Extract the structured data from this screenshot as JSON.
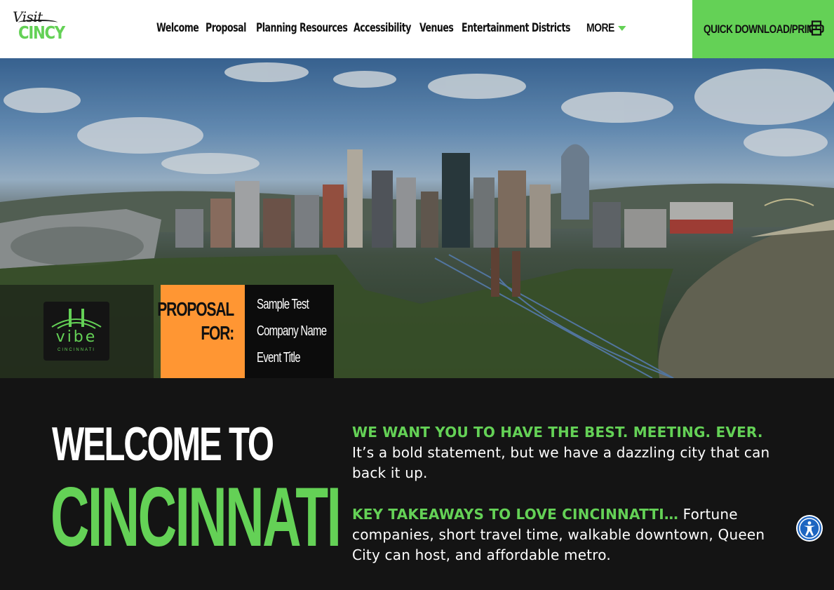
{
  "brand": {
    "logo_top": "Visit",
    "logo_bottom": "CINCY",
    "accent": "#64d156",
    "orange": "#ff9633",
    "dark": "#141414"
  },
  "nav": {
    "items": [
      "Welcome",
      "Proposal",
      "Planning Resources",
      "Accessibility",
      "Venues",
      "Entertainment Districts"
    ],
    "more_label": "MORE",
    "quick_label": "QUICK DOWNLOAD/PRINT",
    "quick_icon": "printer-icon"
  },
  "hero": {
    "vibe_word": "vibe",
    "vibe_sub": "CINCINNATI",
    "proposal_label_1": "PROPOSAL",
    "proposal_label_2": "FOR:",
    "details": [
      "Sample Test",
      "Company Name",
      "Event Title"
    ]
  },
  "welcome": {
    "heading_1": "WELCOME TO",
    "heading_2": "CINCINNATI",
    "para1_highlight": "WE WANT YOU TO HAVE THE BEST. MEETING. EVER.",
    "para1_text": " It’s a bold statement, but we have a dazzling city that can back it up.",
    "para2_highlight": "KEY TAKEAWAYS TO LOVE CINCINNATTI…",
    "para2_text": " Fortune companies, short travel time, walkable downtown, Queen City can host, and affordable metro."
  },
  "accessibility": {
    "icon": "accessibility-icon"
  }
}
